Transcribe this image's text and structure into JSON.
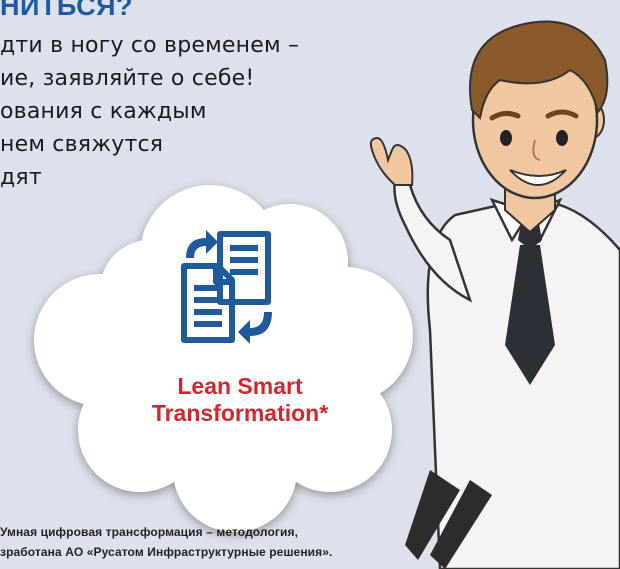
{
  "heading": "НИТЬСЯ?",
  "body_lines": [
    "дти в ногу со временем –",
    "ие, заявляйте о себе!",
    "ования с каждым",
    "нем свяжутся",
    "дят"
  ],
  "brand": {
    "line1": "Lean Smart",
    "line2": "Transformation*"
  },
  "footnote_lines": [
    "Умная цифровая трансформация – методология,",
    "зработана АО «Русатом Инфраструктурные решения»."
  ],
  "icons": {
    "documents": "documents-sync-icon"
  },
  "colors": {
    "heading": "#1d5aa6",
    "brand": "#d1282d",
    "icon": "#1f5a9c",
    "background": "#dde1ec"
  }
}
